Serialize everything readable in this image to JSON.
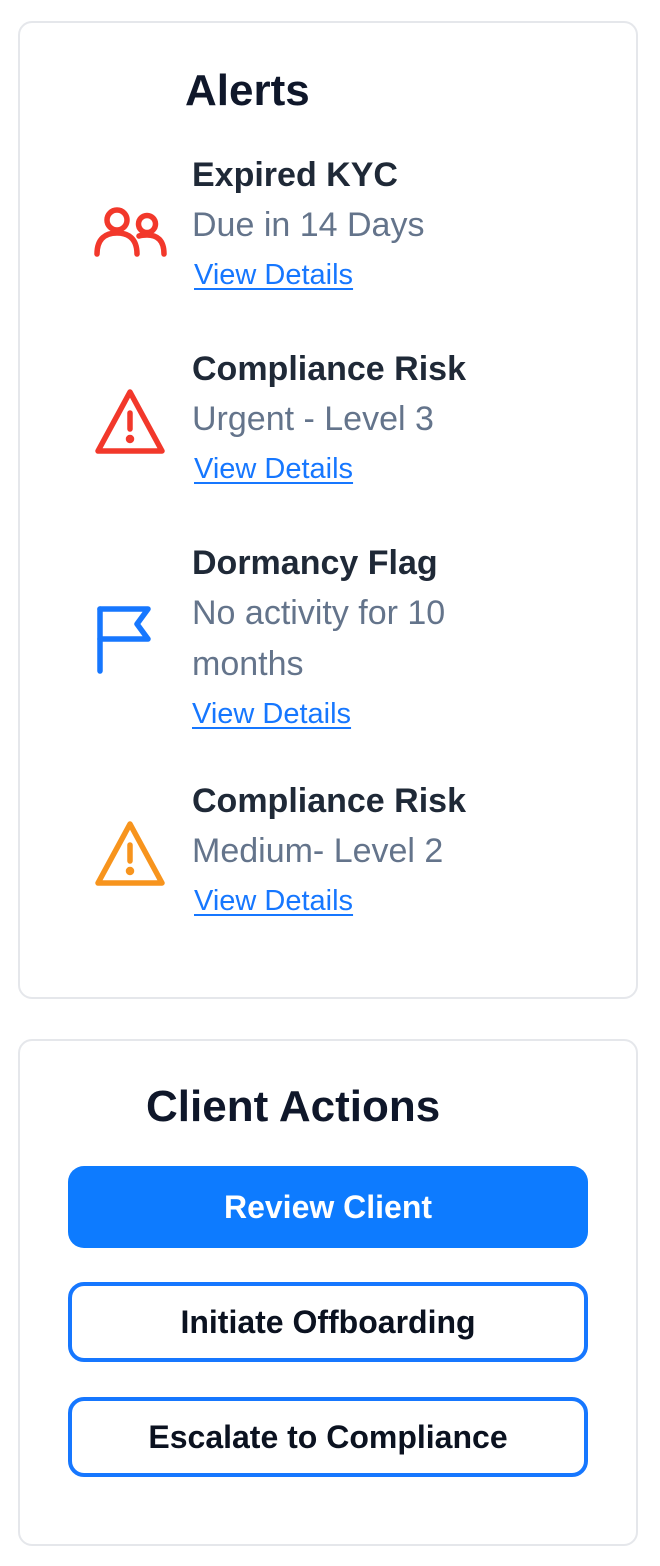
{
  "alerts": {
    "title": "Alerts",
    "items": [
      {
        "icon": "users-icon",
        "icon_color": "#f2382b",
        "title": "Expired KYC",
        "subtitle": "Due in 14 Days",
        "link_label": "View Details"
      },
      {
        "icon": "warning-triangle-icon",
        "icon_color": "#f2382b",
        "title": "Compliance Risk",
        "subtitle": "Urgent - Level 3",
        "link_label": "View Details"
      },
      {
        "icon": "flag-icon",
        "icon_color": "#1677ff",
        "title": "Dormancy Flag",
        "subtitle": "No activity for 10 months",
        "link_label": "View Details"
      },
      {
        "icon": "warning-triangle-icon",
        "icon_color": "#f7941d",
        "title": "Compliance Risk",
        "subtitle": "Medium- Level 2",
        "link_label": "View Details"
      }
    ]
  },
  "client_actions": {
    "title": "Client Actions",
    "review_label": "Review Client",
    "offboard_label": "Initiate Offboarding",
    "escalate_label": "Escalate to Compliance"
  },
  "colors": {
    "accent": "#1677ff",
    "danger": "#f2382b",
    "warning": "#f7941d",
    "heading": "#0f172a",
    "muted": "#64748b"
  }
}
